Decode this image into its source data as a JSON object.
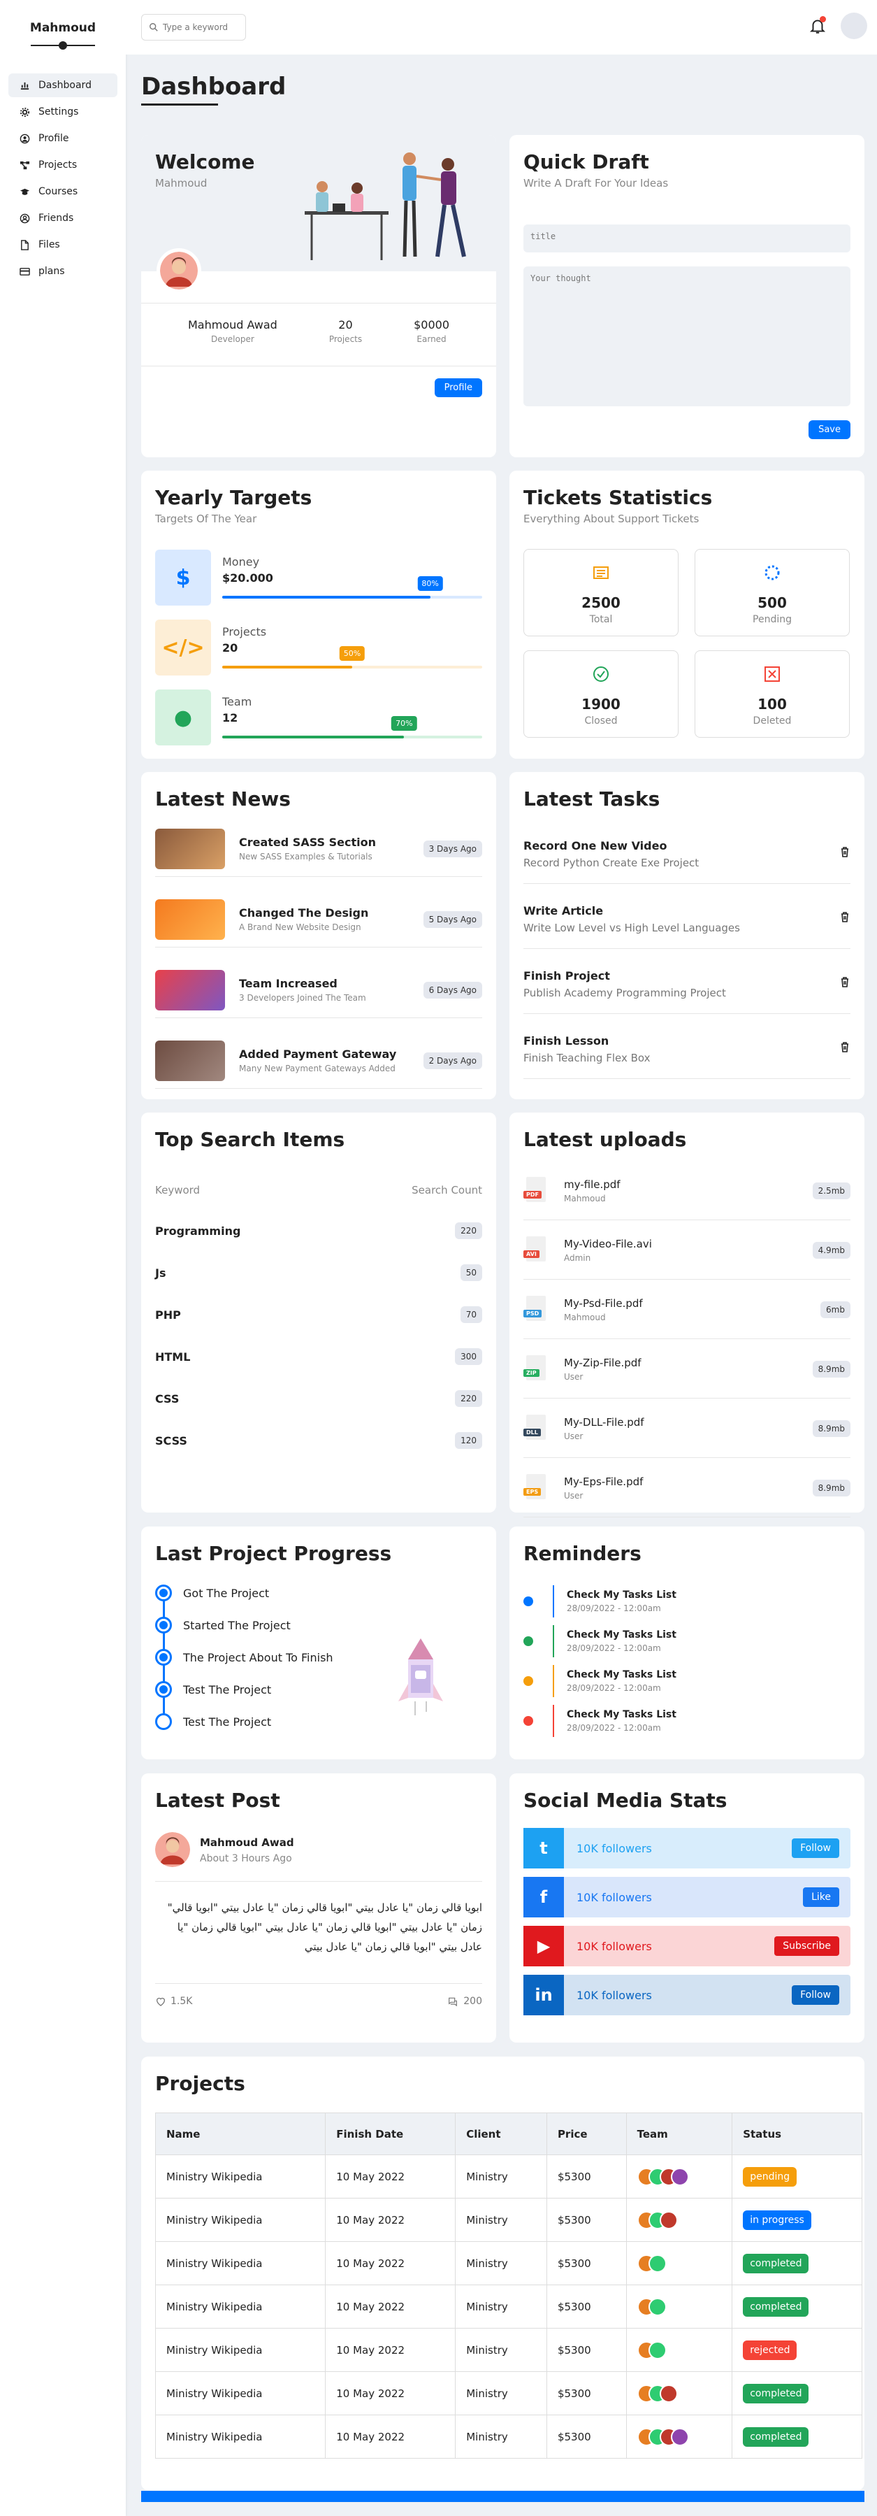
{
  "brand": "Mahmoud",
  "nav": [
    {
      "label": "Dashboard",
      "icon": "chart-icon"
    },
    {
      "label": "Settings",
      "icon": "gear-icon"
    },
    {
      "label": "Profile",
      "icon": "user-icon"
    },
    {
      "label": "Projects",
      "icon": "diagram-icon"
    },
    {
      "label": "Courses",
      "icon": "graduation-cap-icon"
    },
    {
      "label": "Friends",
      "icon": "friends-icon"
    },
    {
      "label": "Files",
      "icon": "file-icon"
    },
    {
      "label": "plans",
      "icon": "card-icon"
    }
  ],
  "search": {
    "placeholder": "Type a keyword"
  },
  "page_title": "Dashboard",
  "welcome": {
    "title": "Welcome",
    "subtitle": "Mahmoud",
    "name": "Mahmoud Awad",
    "role": "Developer",
    "projects": "20",
    "projects_label": "Projects",
    "earned": "$0000",
    "earned_label": "Earned",
    "button": "Profile"
  },
  "draft": {
    "title": "Quick Draft",
    "subtitle": "Write A Draft For Your Ideas",
    "title_placeholder": "title",
    "body_placeholder": "Your thought",
    "button": "Save"
  },
  "targets": {
    "title": "Yearly Targets",
    "subtitle": "Targets Of The Year",
    "items": [
      {
        "label": "Money",
        "value": "$20.000",
        "percent": "80%",
        "fill": 0.8,
        "color": "#0075ff",
        "bg": "#d9e9ff"
      },
      {
        "label": "Projects",
        "value": "20",
        "percent": "50%",
        "fill": 0.5,
        "color": "#f59e0b",
        "bg": "#fdeed6"
      },
      {
        "label": "Team",
        "value": "12",
        "percent": "70%",
        "fill": 0.7,
        "color": "#22a559",
        "bg": "#d5f2e0"
      }
    ]
  },
  "tickets": {
    "title": "Tickets Statistics",
    "subtitle": "Everything About Support Tickets",
    "items": [
      {
        "value": "2500",
        "label": "Total",
        "color": "#f59e0b"
      },
      {
        "value": "500",
        "label": "Pending",
        "color": "#0075ff"
      },
      {
        "value": "1900",
        "label": "Closed",
        "color": "#22a559"
      },
      {
        "value": "100",
        "label": "Deleted",
        "color": "#f44336"
      }
    ]
  },
  "news": {
    "title": "Latest News",
    "items": [
      {
        "title": "Created SASS Section",
        "sub": "New SASS Examples & Tutorials",
        "tag": "3 Days Ago"
      },
      {
        "title": "Changed The Design",
        "sub": "A Brand New Website Design",
        "tag": "5 Days Ago"
      },
      {
        "title": "Team Increased",
        "sub": "3 Developers Joined The Team",
        "tag": "6 Days Ago"
      },
      {
        "title": "Added Payment Gateway",
        "sub": "Many New Payment Gateways Added",
        "tag": "2 Days Ago"
      }
    ]
  },
  "tasks": {
    "title": "Latest Tasks",
    "items": [
      {
        "title": "Record One New Video",
        "sub": "Record Python Create Exe Project"
      },
      {
        "title": "Write Article",
        "sub": "Write Low Level vs High Level Languages"
      },
      {
        "title": "Finish Project",
        "sub": "Publish Academy Programming Project"
      },
      {
        "title": "Finish Lesson",
        "sub": "Finish Teaching Flex Box"
      }
    ]
  },
  "search_items": {
    "title": "Top Search Items",
    "col1": "Keyword",
    "col2": "Search Count",
    "rows": [
      {
        "k": "Programming",
        "v": "220"
      },
      {
        "k": "Js",
        "v": "50"
      },
      {
        "k": "PHP",
        "v": "70"
      },
      {
        "k": "HTML",
        "v": "300"
      },
      {
        "k": "CSS",
        "v": "220"
      },
      {
        "k": "SCSS",
        "v": "120"
      }
    ]
  },
  "uploads": {
    "title": "Latest uploads",
    "items": [
      {
        "name": "my-file.pdf",
        "by": "Mahmoud",
        "size": "2.5mb",
        "ext": "PDF",
        "color": "#e74c3c"
      },
      {
        "name": "My-Video-File.avi",
        "by": "Admin",
        "size": "4.9mb",
        "ext": "AVI",
        "color": "#e74c3c"
      },
      {
        "name": "My-Psd-File.pdf",
        "by": "Mahmoud",
        "size": "6mb",
        "ext": "PSD",
        "color": "#3498db"
      },
      {
        "name": "My-Zip-File.pdf",
        "by": "User",
        "size": "8.9mb",
        "ext": "ZIP",
        "color": "#27ae60"
      },
      {
        "name": "My-DLL-File.pdf",
        "by": "User",
        "size": "8.9mb",
        "ext": "DLL",
        "color": "#34495e"
      },
      {
        "name": "My-Eps-File.pdf",
        "by": "User",
        "size": "8.9mb",
        "ext": "EPS",
        "color": "#f39c12"
      }
    ]
  },
  "progress": {
    "title": "Last Project Progress",
    "steps": [
      {
        "label": "Got The Project",
        "done": true
      },
      {
        "label": "Started The Project",
        "done": true
      },
      {
        "label": "The Project About To Finish",
        "done": true
      },
      {
        "label": "Test The Project",
        "done": true
      },
      {
        "label": "Test The Project",
        "done": false
      }
    ]
  },
  "reminders": {
    "title": "Reminders",
    "items": [
      {
        "title": "Check My Tasks List",
        "date": "28/09/2022 - 12:00am",
        "color": "#0075ff"
      },
      {
        "title": "Check My Tasks List",
        "date": "28/09/2022 - 12:00am",
        "color": "#22a559"
      },
      {
        "title": "Check My Tasks List",
        "date": "28/09/2022 - 12:00am",
        "color": "#f59e0b"
      },
      {
        "title": "Check My Tasks List",
        "date": "28/09/2022 - 12:00am",
        "color": "#f44336"
      }
    ]
  },
  "post": {
    "title": "Latest Post",
    "author": "Mahmoud Awad",
    "time": "About 3 Hours Ago",
    "text": "ابويا قالي زمان \"يا عادل بيتي \"ابويا قالي زمان \"يا عادل بيتي \"ابويا قالي\" زمان \"يا عادل بيتي \"ابويا قالي زمان \"يا عادل بيتي \"ابويا قالي زمان \"يا عادل بيتي \"ابويا قالي زمان \"يا عادل بيتي",
    "likes": "1.5K",
    "comments": "200"
  },
  "social": {
    "title": "Social Media Stats",
    "items": [
      {
        "text": "10K followers",
        "button": "Follow",
        "color": "#1da1f2",
        "bg": "#d8edfc",
        "icon": "twitter-icon",
        "glyph": "t"
      },
      {
        "text": "10K followers",
        "button": "Like",
        "color": "#1877f2",
        "bg": "#d9e6fb",
        "icon": "facebook-icon",
        "glyph": "f"
      },
      {
        "text": "10K followers",
        "button": "Subscribe",
        "color": "#e0191e",
        "bg": "#fbd5d6",
        "icon": "youtube-icon",
        "glyph": "▶"
      },
      {
        "text": "10K followers",
        "button": "Follow",
        "color": "#0a66c2",
        "bg": "#d2e2f2",
        "icon": "linkedin-icon",
        "glyph": "in"
      }
    ]
  },
  "projects": {
    "title": "Projects",
    "headers": [
      "Name",
      "Finish Date",
      "Client",
      "Price",
      "Team",
      "Status"
    ],
    "rows": [
      {
        "name": "Ministry Wikipedia",
        "date": "10 May 2022",
        "client": "Ministry",
        "price": "$5300",
        "team": 4,
        "status": "pending",
        "color": "#f59e0b"
      },
      {
        "name": "Ministry Wikipedia",
        "date": "10 May 2022",
        "client": "Ministry",
        "price": "$5300",
        "team": 3,
        "status": "in progress",
        "color": "#0075ff"
      },
      {
        "name": "Ministry Wikipedia",
        "date": "10 May 2022",
        "client": "Ministry",
        "price": "$5300",
        "team": 2,
        "status": "completed",
        "color": "#22a559"
      },
      {
        "name": "Ministry Wikipedia",
        "date": "10 May 2022",
        "client": "Ministry",
        "price": "$5300",
        "team": 2,
        "status": "completed",
        "color": "#22a559"
      },
      {
        "name": "Ministry Wikipedia",
        "date": "10 May 2022",
        "client": "Ministry",
        "price": "$5300",
        "team": 2,
        "status": "rejected",
        "color": "#f44336"
      },
      {
        "name": "Ministry Wikipedia",
        "date": "10 May 2022",
        "client": "Ministry",
        "price": "$5300",
        "team": 3,
        "status": "completed",
        "color": "#22a559"
      },
      {
        "name": "Ministry Wikipedia",
        "date": "10 May 2022",
        "client": "Ministry",
        "price": "$5300",
        "team": 4,
        "status": "completed",
        "color": "#22a559"
      }
    ]
  }
}
